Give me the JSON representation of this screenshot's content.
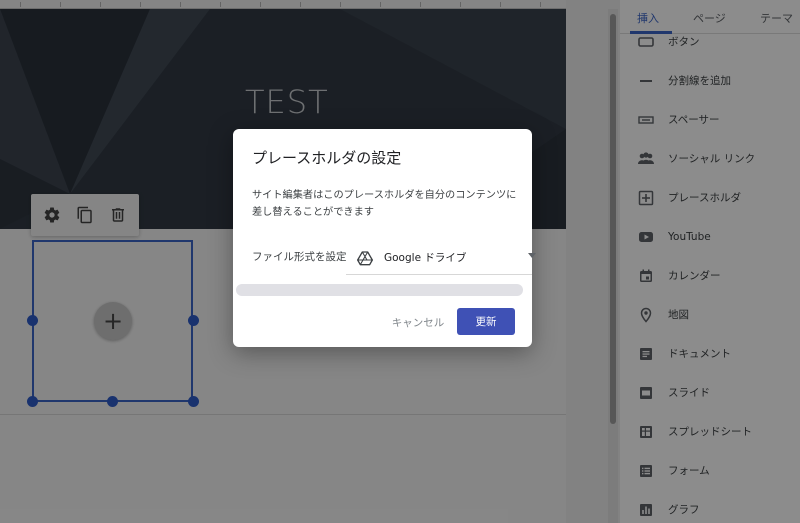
{
  "page": {
    "hero_title": "TEST"
  },
  "toolbar": {
    "icons": [
      "gear-icon",
      "copy-icon",
      "trash-icon"
    ]
  },
  "placeholder": {
    "add_label": "+"
  },
  "panel": {
    "tabs": [
      {
        "label": "挿入",
        "active": true
      },
      {
        "label": "ページ",
        "active": false
      },
      {
        "label": "テーマ",
        "active": false
      }
    ],
    "items": [
      {
        "label": "ボタン",
        "icon": "button-icon"
      },
      {
        "label": "分割線を追加",
        "icon": "divider-icon"
      },
      {
        "label": "スペーサー",
        "icon": "spacer-icon"
      },
      {
        "label": "ソーシャル リンク",
        "icon": "people-icon"
      },
      {
        "label": "プレースホルダ",
        "icon": "plus-box-icon"
      },
      {
        "label": "YouTube",
        "icon": "youtube-icon"
      },
      {
        "label": "カレンダー",
        "icon": "calendar-icon"
      },
      {
        "label": "地図",
        "icon": "map-pin-icon"
      },
      {
        "label": "ドキュメント",
        "icon": "docs-icon"
      },
      {
        "label": "スライド",
        "icon": "slides-icon"
      },
      {
        "label": "スプレッドシート",
        "icon": "sheets-icon"
      },
      {
        "label": "フォーム",
        "icon": "forms-icon"
      },
      {
        "label": "グラフ",
        "icon": "chart-icon"
      }
    ]
  },
  "dialog": {
    "title": "プレースホルダの設定",
    "description": "サイト編集者はこのプレースホルダを自分のコンテンツに差し替えることができます",
    "field_label": "ファイル形式を設定",
    "select_value": "Google ドライブ",
    "progress": 0,
    "cancel_label": "キャンセル",
    "update_label": "更新"
  },
  "colors": {
    "accent": "#3b64c6",
    "button": "#3f51b5",
    "hero": "#343c47"
  }
}
